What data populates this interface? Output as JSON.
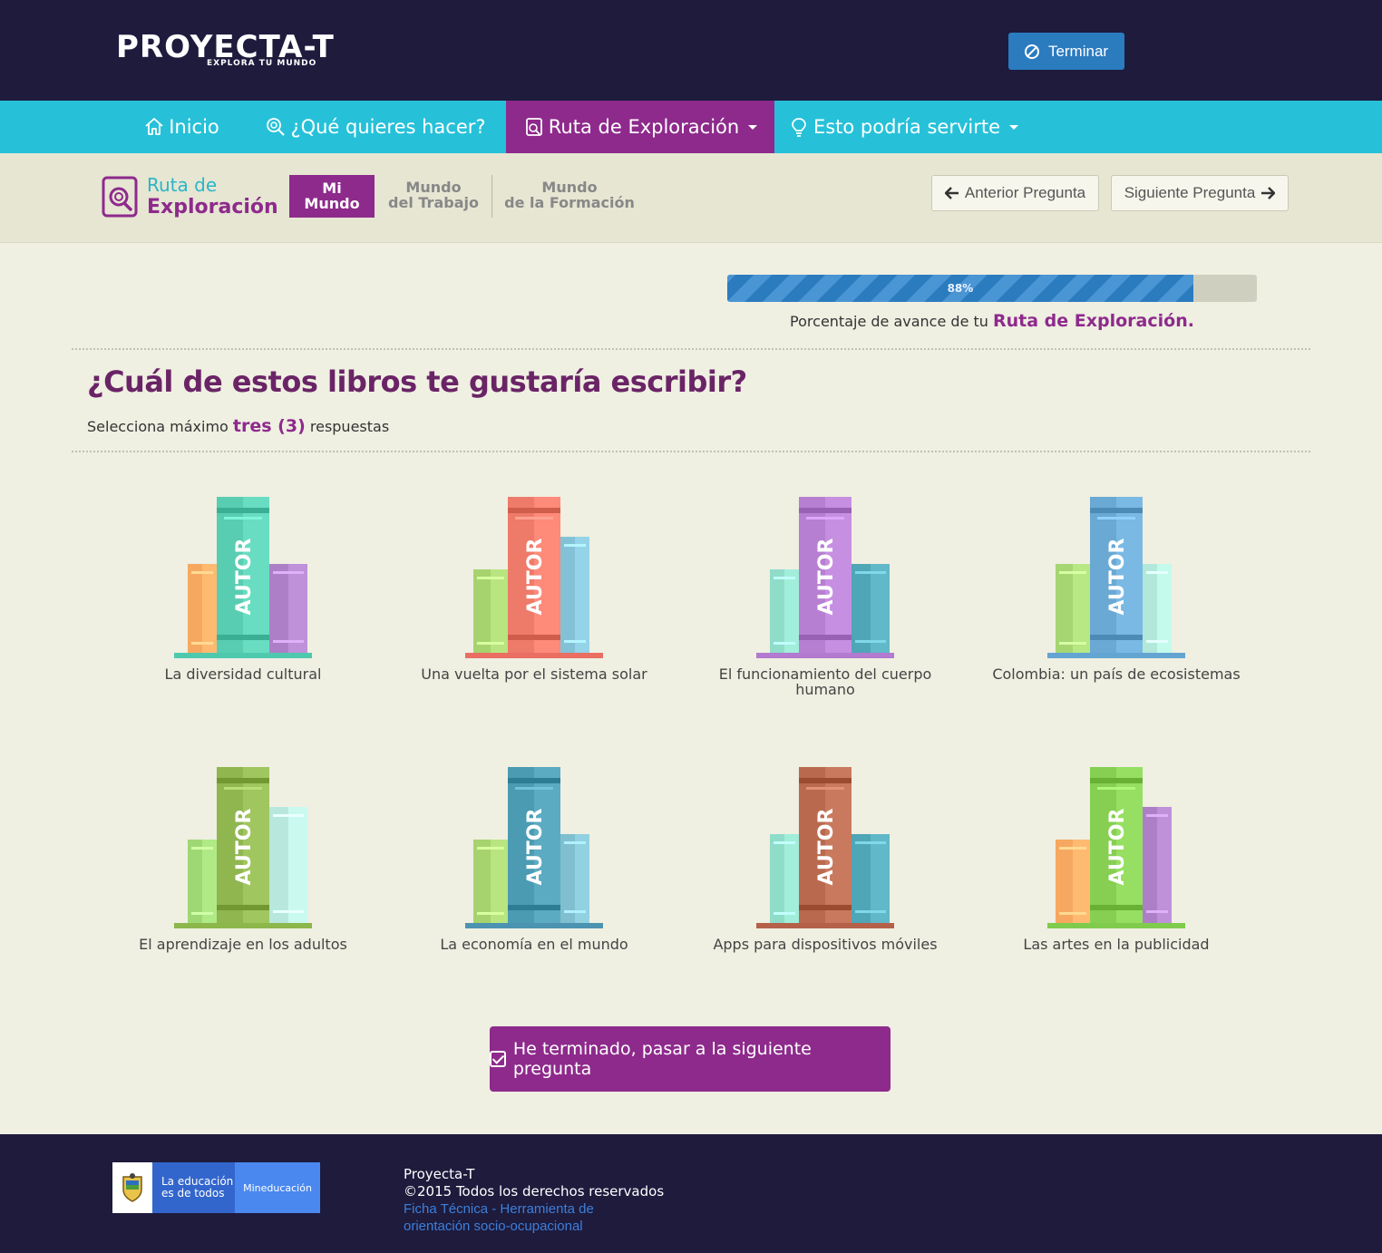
{
  "header": {
    "logo_main": "PROYECTA-T",
    "logo_sub": "EXPLORA TU MUNDO",
    "terminate_label": "Terminar"
  },
  "nav": {
    "items": [
      {
        "label": "Inicio",
        "icon": "home-icon"
      },
      {
        "label": "¿Qué quieres hacer?",
        "icon": "search-icon"
      },
      {
        "label": "Ruta de Exploración",
        "icon": "document-search-icon"
      },
      {
        "label": "Esto podría servirte",
        "icon": "lightbulb-icon"
      }
    ],
    "active_index": 2
  },
  "route": {
    "title_line1": "Ruta de",
    "title_line2": "Exploración",
    "tabs": [
      {
        "line1": "Mi",
        "line2": "Mundo"
      },
      {
        "line1": "Mundo",
        "line2": "del Trabajo"
      },
      {
        "line1": "Mundo",
        "line2": "de la Formación"
      }
    ],
    "prev_label": "Anterior Pregunta",
    "next_label": "Siguiente Pregunta"
  },
  "progress": {
    "value": 0.88,
    "label": "88%",
    "caption_prefix": "Porcentaje de avance de tu ",
    "caption_strong": "Ruta de Exploración."
  },
  "question": {
    "title": "¿Cuál de estos libros te gustaría escribir?",
    "instruction_prefix": "Selecciona máximo ",
    "instruction_strong": "tres (3)",
    "instruction_suffix": " respuestas"
  },
  "books": {
    "spine_text": "AUTOR",
    "items": [
      {
        "label": "La diversidad cultural",
        "colors": [
          "#f6a860",
          "#59cdb1",
          "#ad7fc7"
        ],
        "shelf": "#4fc9ae"
      },
      {
        "label": "Una vuelta por el sistema solar",
        "colors": [
          "#a6d36e",
          "#ee7a6a",
          "#83c2d6"
        ],
        "shelf": "#ea6e62"
      },
      {
        "label": "El funcionamiento del cuerpo humano",
        "colors": [
          "#8fdcc9",
          "#b77fd1",
          "#4ea6b6"
        ],
        "shelf": "#b27ad0"
      },
      {
        "label": "Colombia: un país de ecosistemas",
        "colors": [
          "#a5d672",
          "#6aa9d4",
          "#b2e8da"
        ],
        "shelf": "#62a4d2"
      },
      {
        "label": "El aprendizaje en los adultos",
        "colors": [
          "#9ed874",
          "#90b650",
          "#b8e8dd"
        ],
        "shelf": "#8cb74b"
      },
      {
        "label": "La economía en el mundo",
        "colors": [
          "#a6d36e",
          "#4b9bb3",
          "#7fbfcf"
        ],
        "shelf": "#4b93b0"
      },
      {
        "label": "Apps para dispositivos móviles",
        "colors": [
          "#8fdcc9",
          "#b96a4e",
          "#4ea6b6"
        ],
        "shelf": "#b5614a"
      },
      {
        "label": "Las artes en la publicidad",
        "colors": [
          "#f6a860",
          "#86cf52",
          "#ad7fc7"
        ],
        "shelf": "#7fcc4c"
      }
    ]
  },
  "submit_label": "He terminado, pasar a la siguiente pregunta",
  "footer": {
    "edu_line1": "La educación",
    "edu_line2": "es de todos",
    "ministry": "Mineducación",
    "name": "Proyecta-T",
    "copyright": "©2015 Todos los derechos reservados",
    "link_line1": "Ficha Técnica - Herramienta de",
    "link_line2": "orientación socio-ocupacional"
  }
}
